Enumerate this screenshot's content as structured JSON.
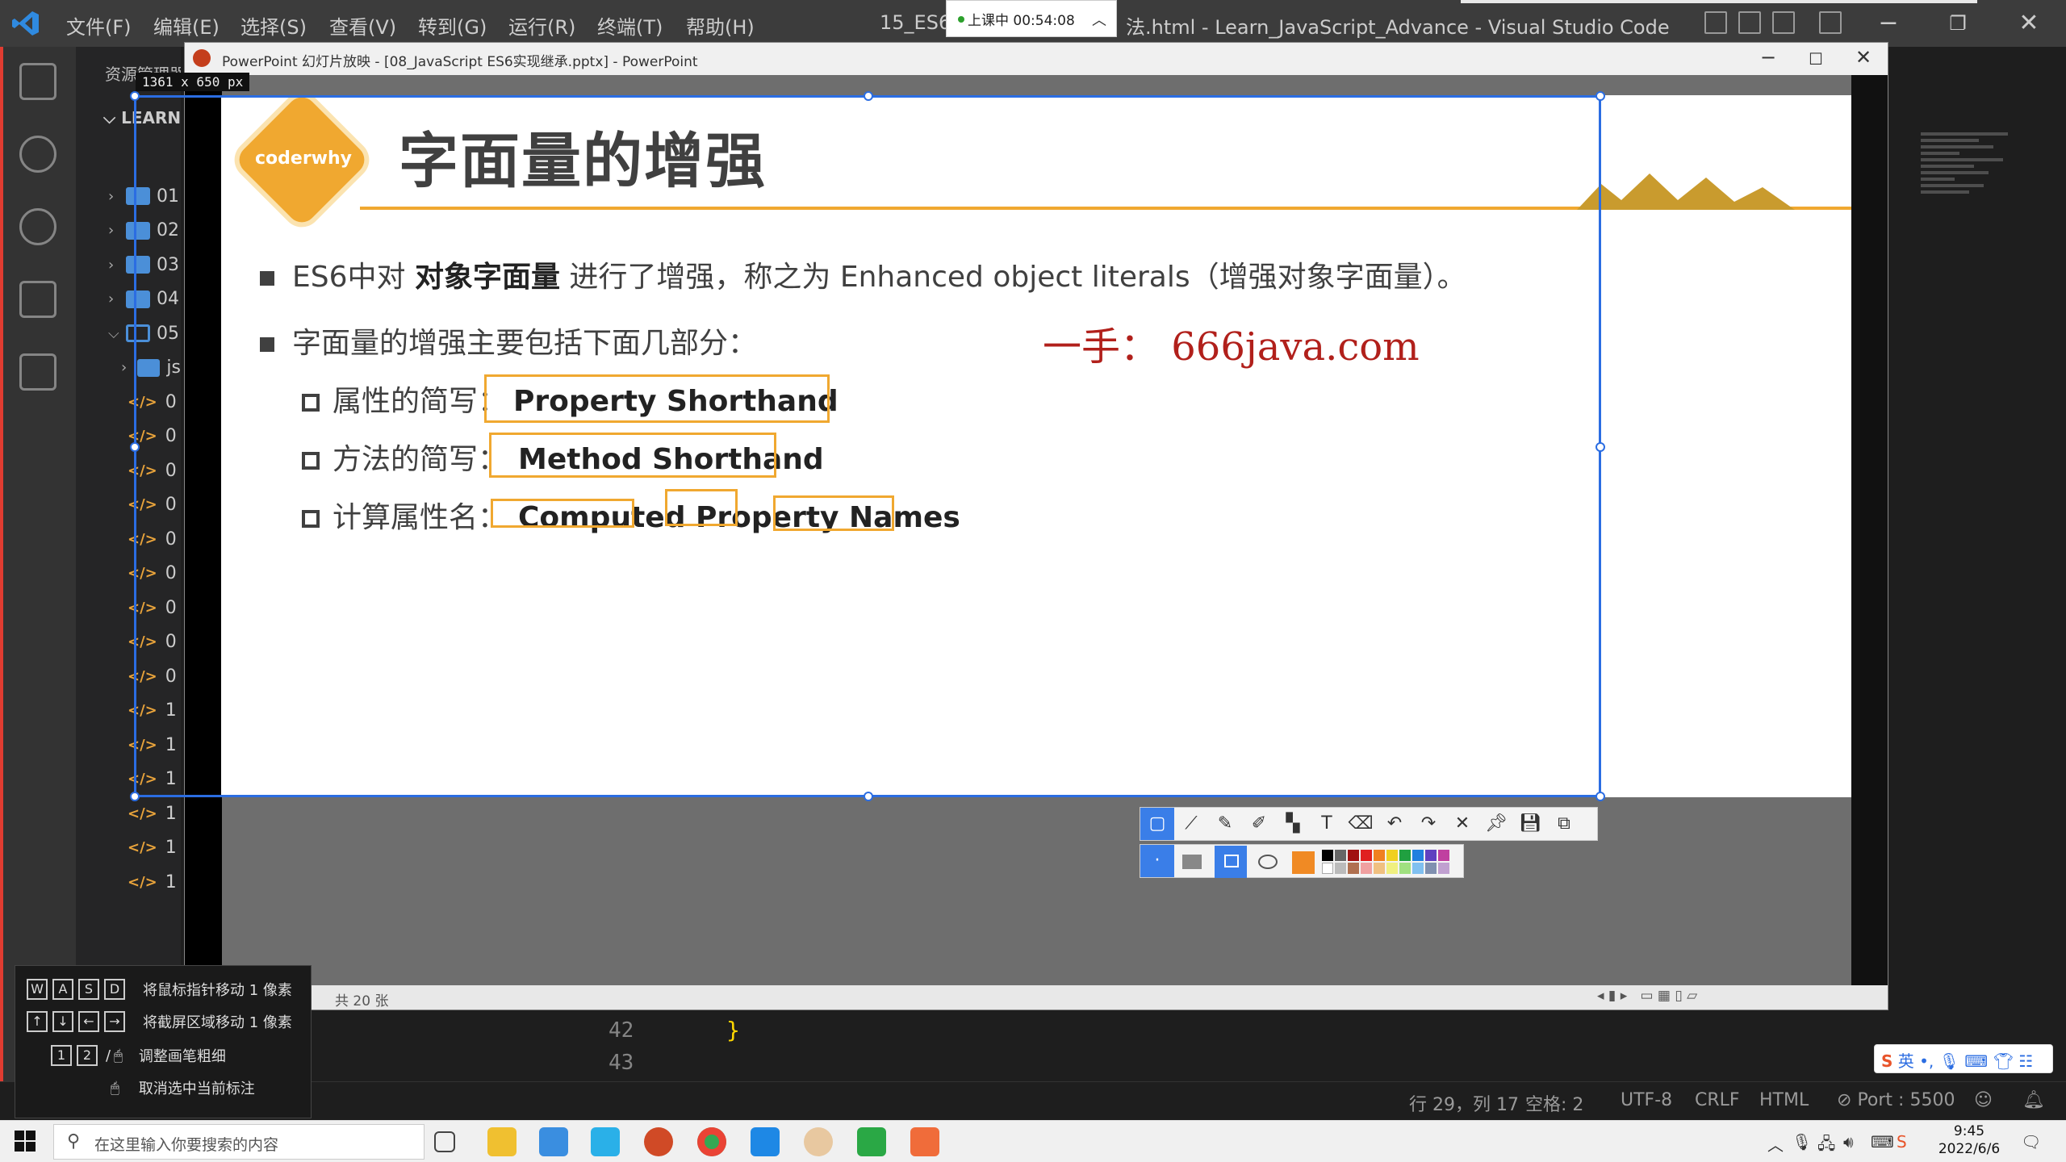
{
  "vscode": {
    "menu": [
      "文件(F)",
      "编辑(E)",
      "选择(S)",
      "查看(V)",
      "转到(G)",
      "运行(R)",
      "终端(T)",
      "帮助(H)"
    ],
    "file_title_left": "15_ES6",
    "window_title": "法.html - Learn_JavaScript_Advance - Visual Studio Code",
    "explorer_header": "资源管理器",
    "explorer_root": "LEARN_JA",
    "explorer_rows": [
      {
        "label": "01",
        "kind": "folder"
      },
      {
        "label": "02",
        "kind": "folder"
      },
      {
        "label": "03",
        "kind": "folder"
      },
      {
        "label": "04",
        "kind": "folder"
      },
      {
        "label": "05",
        "kind": "folder-open"
      },
      {
        "label": "js",
        "kind": "folder"
      },
      {
        "label": "0",
        "kind": "file"
      },
      {
        "label": "0",
        "kind": "file"
      },
      {
        "label": "0",
        "kind": "file"
      },
      {
        "label": "0",
        "kind": "file"
      },
      {
        "label": "0",
        "kind": "file"
      },
      {
        "label": "0",
        "kind": "file"
      },
      {
        "label": "0",
        "kind": "file"
      },
      {
        "label": "0",
        "kind": "file"
      },
      {
        "label": "0",
        "kind": "file"
      },
      {
        "label": "1",
        "kind": "file"
      },
      {
        "label": "1",
        "kind": "file"
      },
      {
        "label": "1",
        "kind": "file"
      },
      {
        "label": "1",
        "kind": "file"
      },
      {
        "label": "1",
        "kind": "file"
      },
      {
        "label": "1",
        "kind": "file"
      }
    ],
    "line_numbers": [
      "42",
      "43"
    ],
    "closing_brace": "}",
    "status": {
      "position": "行 29，列 17",
      "spaces": "空格: 2",
      "encoding": "UTF-8",
      "eol": "CRLF",
      "language": "HTML",
      "port": "Port : 5500"
    }
  },
  "timer": {
    "label": "上课中 00:54:08"
  },
  "powerpoint": {
    "title": "PowerPoint 幻灯片放映 - [08_JavaScript ES6实现继承.pptx] - PowerPoint",
    "slide_count": "共 20 张"
  },
  "selection": {
    "size_label": "1361 x 650  px"
  },
  "slide": {
    "logo": "coderwhy",
    "title": "字面量的增强",
    "bullet1_pre": "ES6中对 ",
    "bullet1_kw": "对象字面量",
    "bullet1_post": " 进行了增强，称之为 Enhanced object literals（增强对象字面量）。",
    "bullet2": "字面量的增强主要包括下面几部分：",
    "watermark": "一手：  666java.com",
    "sub1_label": "属性的简写：",
    "sub1_value": "Property Shorthand",
    "sub2_label": "方法的简写：",
    "sub2_value": "Method Shorthand",
    "sub3_label": "计算属性名：",
    "sub3_value": "Computed Property Names"
  },
  "key_help": [
    {
      "keys": [
        "W",
        "A",
        "S",
        "D"
      ],
      "text": "将鼠标指针移动 1 像素"
    },
    {
      "keys": [
        "↑",
        "↓",
        "←",
        "→"
      ],
      "text": "将截屏区域移动 1 像素"
    },
    {
      "keys": [
        "1",
        "2"
      ],
      "text": "调整画笔粗细"
    },
    {
      "keys": [],
      "text": "取消选中当前标注"
    }
  ],
  "taskbar": {
    "search_placeholder": "在这里输入你要搜索的内容",
    "time": "9:45",
    "date": "2022/6/6",
    "ime": "英"
  },
  "colors": {
    "accent_orange": "#f0a830",
    "selection_blue": "#2b6de2",
    "watermark_red": "#b1201b"
  }
}
